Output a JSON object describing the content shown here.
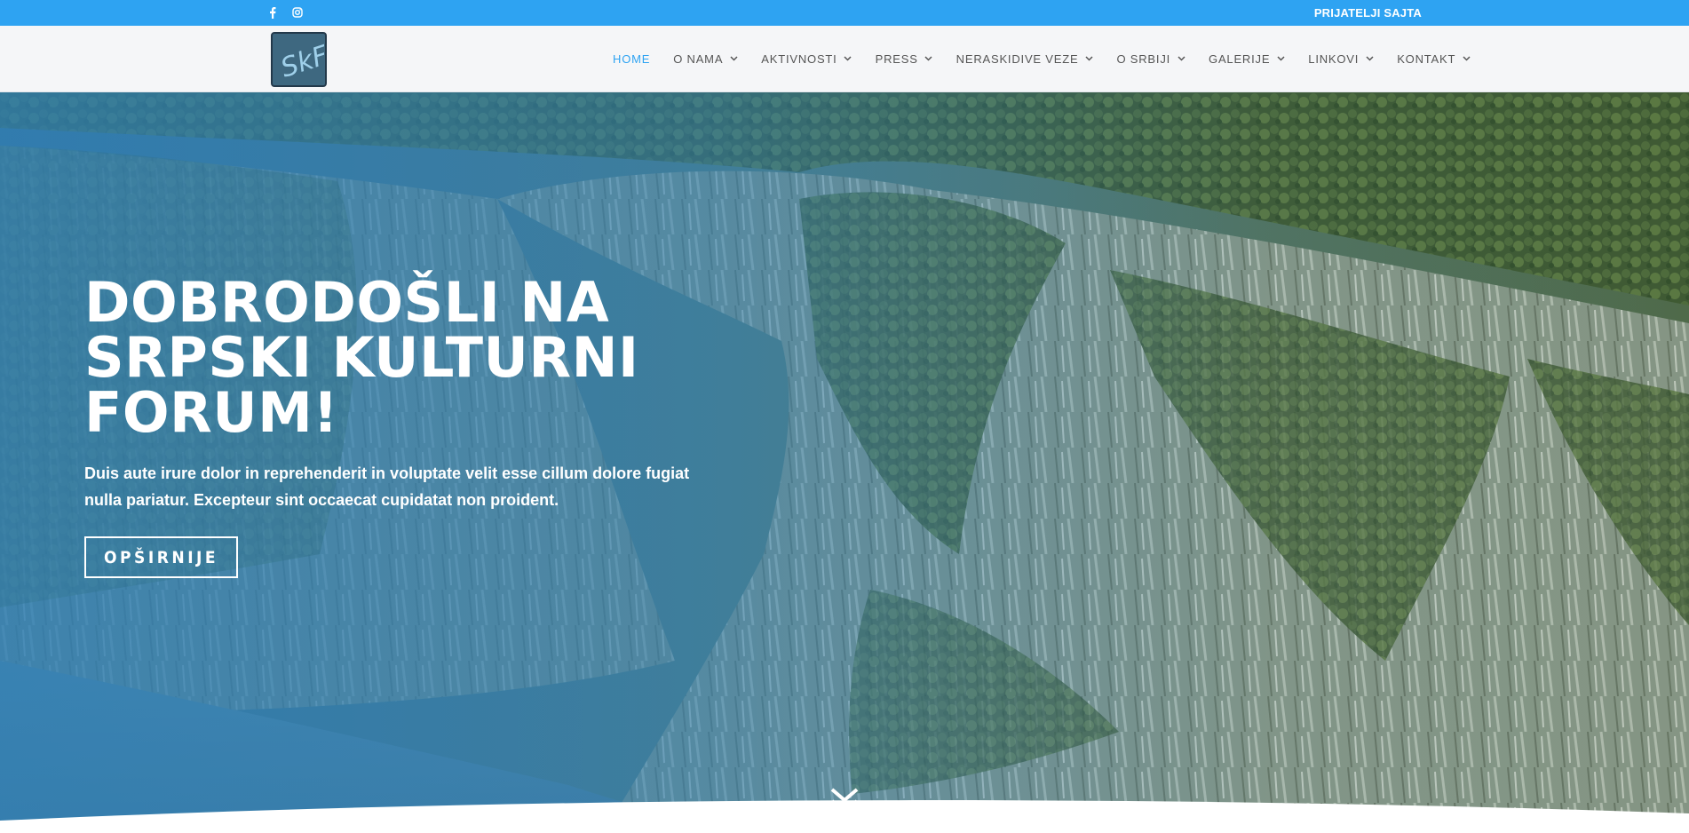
{
  "topbar": {
    "social": [
      {
        "icon": "facebook-icon",
        "glyph": "f"
      },
      {
        "icon": "instagram-icon"
      }
    ],
    "friends_link": "PRIJATELJI SAJTA"
  },
  "header": {
    "logo_text": "SkF",
    "nav": [
      {
        "label": "HOME",
        "active": true,
        "dropdown": false
      },
      {
        "label": "O NAMA",
        "active": false,
        "dropdown": true
      },
      {
        "label": "AKTIVNOSTI",
        "active": false,
        "dropdown": true
      },
      {
        "label": "PRESS",
        "active": false,
        "dropdown": true
      },
      {
        "label": "NERASKIDIVE VEZE",
        "active": false,
        "dropdown": true
      },
      {
        "label": "O SRBIJI",
        "active": false,
        "dropdown": true
      },
      {
        "label": "GALERIJE",
        "active": false,
        "dropdown": true
      },
      {
        "label": "LINKOVI",
        "active": false,
        "dropdown": true
      },
      {
        "label": "KONTAKT",
        "active": false,
        "dropdown": true
      }
    ]
  },
  "hero": {
    "title": "DOBRODOŠLI NA\nSRPSKI KULTURNI\nFORUM!",
    "text": "Duis aute irure dolor in reprehenderit in voluptate velit esse cillum dolore fugiat nulla pariatur. Excepteur sint occaecat cupidatat non proident.",
    "button": "OPŠIRNIJE",
    "scroll_icon": "double-chevron-down-icon"
  },
  "colors": {
    "accent": "#2ea3f2",
    "header_bg": "#f5f6f8",
    "nav_text": "#555555",
    "hero_overlay": "#2e7fb6"
  }
}
